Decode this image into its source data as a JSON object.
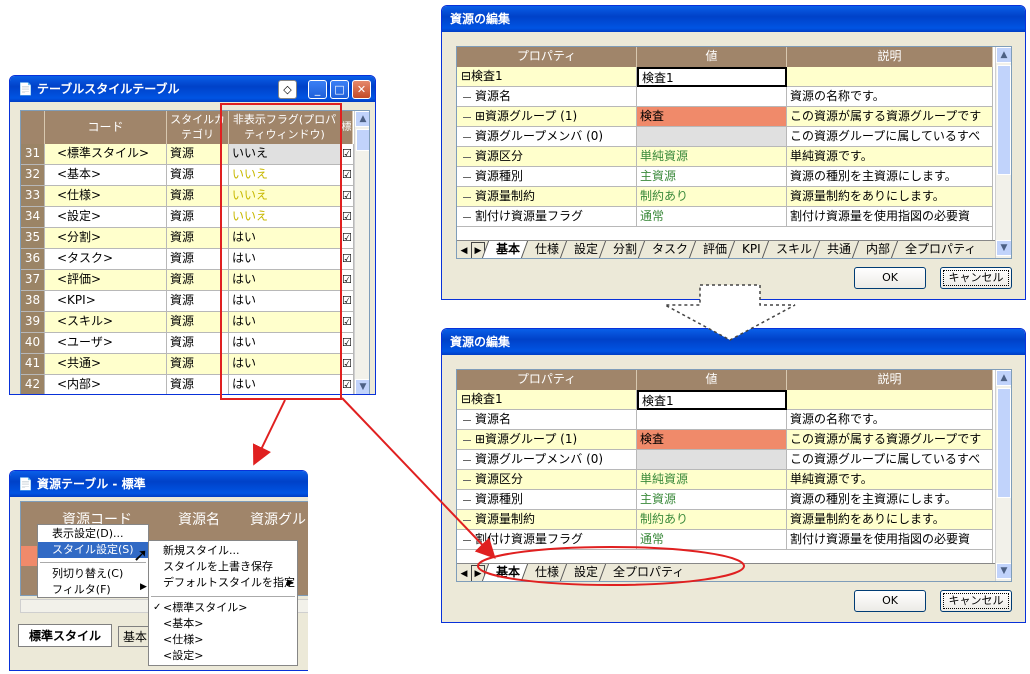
{
  "win1": {
    "title": "テーブルスタイルテーブル",
    "headers": [
      "コード",
      "スタイルカテゴリ",
      "非表示フラグ(プロパティウィンドウ)",
      "標"
    ],
    "rows": [
      {
        "n": "31",
        "code": "<標準スタイル>",
        "cat": "資源",
        "flag": "いいえ"
      },
      {
        "n": "32",
        "code": "<基本>",
        "cat": "資源",
        "flag": "いいえ"
      },
      {
        "n": "33",
        "code": "<仕様>",
        "cat": "資源",
        "flag": "いいえ"
      },
      {
        "n": "34",
        "code": "<設定>",
        "cat": "資源",
        "flag": "いいえ"
      },
      {
        "n": "35",
        "code": "<分割>",
        "cat": "資源",
        "flag": "はい"
      },
      {
        "n": "36",
        "code": "<タスク>",
        "cat": "資源",
        "flag": "はい"
      },
      {
        "n": "37",
        "code": "<評価>",
        "cat": "資源",
        "flag": "はい"
      },
      {
        "n": "38",
        "code": "<KPI>",
        "cat": "資源",
        "flag": "はい"
      },
      {
        "n": "39",
        "code": "<スキル>",
        "cat": "資源",
        "flag": "はい"
      },
      {
        "n": "40",
        "code": "<ユーザ>",
        "cat": "資源",
        "flag": "はい"
      },
      {
        "n": "41",
        "code": "<共通>",
        "cat": "資源",
        "flag": "はい"
      },
      {
        "n": "42",
        "code": "<内部>",
        "cat": "資源",
        "flag": "はい"
      }
    ]
  },
  "win2": {
    "title": "資源テーブル - 標準",
    "headers": [
      "資源コード",
      "資源名",
      "資源グル"
    ],
    "tabs": [
      "標準スタイル",
      "基本"
    ],
    "menu1": [
      "表示設定(D)...",
      "スタイル設定(S)",
      "列切り替え(C)",
      "フィルタ(F)"
    ],
    "menu2": [
      "新規スタイル...",
      "スタイルを上書き保存",
      "デフォルトスタイルを指定"
    ],
    "styles": [
      "<標準スタイル>",
      "<基本>",
      "<仕様>",
      "<設定>"
    ]
  },
  "edit": {
    "title": "資源の編集",
    "headers": [
      "プロパティ",
      "値",
      "説明"
    ],
    "rows": [
      {
        "p": "⊟検査1",
        "v": "検査1",
        "d": ""
      },
      {
        "p": "資源名",
        "v": "",
        "d": "資源の名称です。"
      },
      {
        "p": "⊞資源グループ (1)",
        "v": "検査",
        "d": "この資源が属する資源グループです"
      },
      {
        "p": "資源グループメンバ (0)",
        "v": "",
        "d": "この資源グループに属しているすべ"
      },
      {
        "p": "資源区分",
        "v": "単純資源",
        "d": "単純資源です。"
      },
      {
        "p": "資源種別",
        "v": "主資源",
        "d": "資源の種別を主資源にします。"
      },
      {
        "p": "資源量制約",
        "v": "制約あり",
        "d": "資源量制約をありにします。"
      },
      {
        "p": "割付け資源量フラグ",
        "v": "通常",
        "d": "割付け資源量を使用指図の必要資"
      }
    ],
    "tabsA": [
      "基本",
      "仕様",
      "設定",
      "分割",
      "タスク",
      "評価",
      "KPI",
      "スキル",
      "共通",
      "内部",
      "全プロパティ"
    ],
    "tabsB": [
      "基本",
      "仕様",
      "設定",
      "全プロパティ"
    ],
    "ok": "OK",
    "cancel": "キャンセル"
  },
  "colors": {
    "highlight": "#e02020",
    "titlebar": "#0054e3"
  }
}
